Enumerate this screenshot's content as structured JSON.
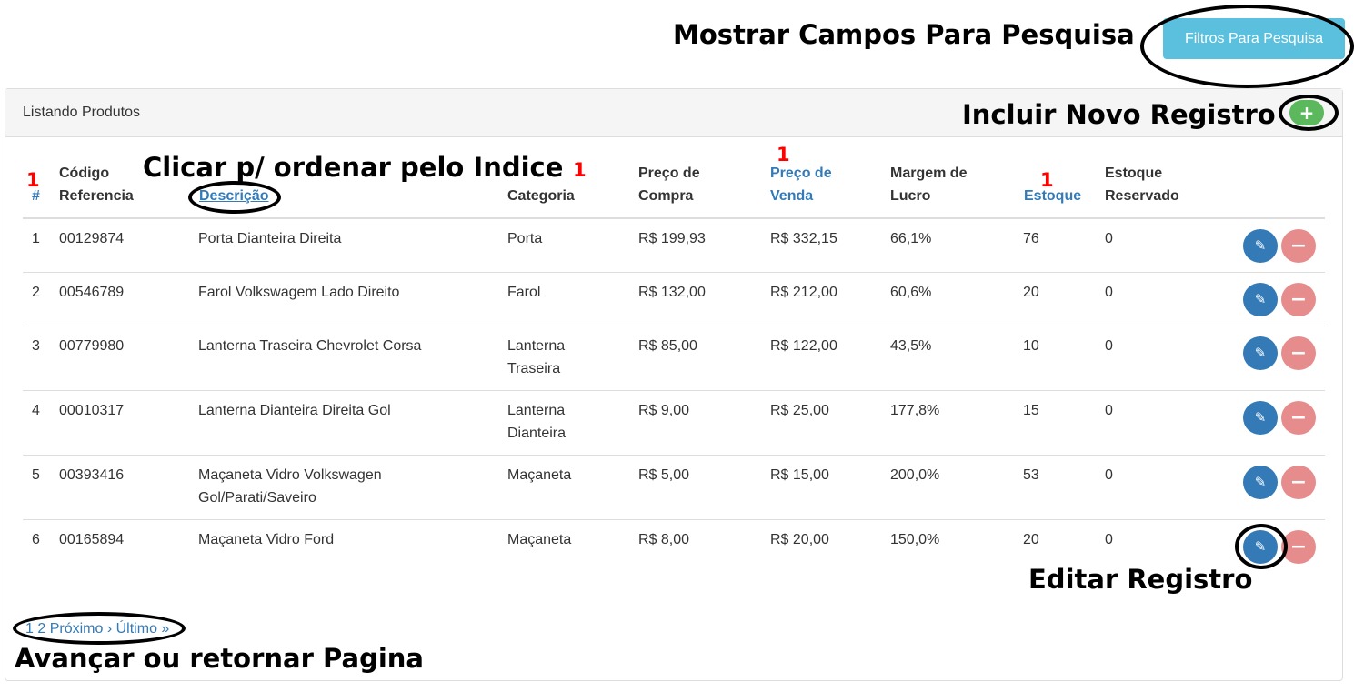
{
  "annotations": {
    "show_fields": "Mostrar Campos Para Pesquisa",
    "add_new": "Incluir Novo Registro",
    "click_sort": "Clicar p/ ordenar pelo Indice",
    "edit_record": "Editar Registro",
    "pagination": "Avançar ou retornar Pagina",
    "markers": [
      "1",
      "1",
      "1",
      "1"
    ]
  },
  "toolbar": {
    "filter_button": "Filtros Para Pesquisa"
  },
  "panel": {
    "title": "Listando Produtos",
    "add_icon": "plus-icon",
    "add_symbol": "+"
  },
  "table": {
    "headers": {
      "index": "#",
      "code_l1": "Código",
      "code_l2": "Referencia",
      "description": "Descrição",
      "category": "Categoria",
      "buy_l1": "Preço de",
      "buy_l2": "Compra",
      "sell_l1": "Preço de",
      "sell_l2": "Venda",
      "margin_l1": "Margem de",
      "margin_l2": "Lucro",
      "stock": "Estoque",
      "reserved_l1": "Estoque",
      "reserved_l2": "Reservado"
    },
    "rows": [
      {
        "index": "1",
        "code": "00129874",
        "desc_l1": "Porta Dianteira Direita",
        "desc_l2": "",
        "cat_l1": "Porta",
        "cat_l2": "",
        "buy": "R$ 199,93",
        "sell": "R$ 332,15",
        "margin": "66,1%",
        "stock": "76",
        "reserved": "0"
      },
      {
        "index": "2",
        "code": "00546789",
        "desc_l1": "Farol Volkswagem Lado Direito",
        "desc_l2": "",
        "cat_l1": "Farol",
        "cat_l2": "",
        "buy": "R$ 132,00",
        "sell": "R$ 212,00",
        "margin": "60,6%",
        "stock": "20",
        "reserved": "0"
      },
      {
        "index": "3",
        "code": "00779980",
        "desc_l1": "Lanterna Traseira Chevrolet Corsa",
        "desc_l2": "",
        "cat_l1": "Lanterna",
        "cat_l2": "Traseira",
        "buy": "R$ 85,00",
        "sell": "R$ 122,00",
        "margin": "43,5%",
        "stock": "10",
        "reserved": "0"
      },
      {
        "index": "4",
        "code": "00010317",
        "desc_l1": "Lanterna Dianteira Direita Gol",
        "desc_l2": "",
        "cat_l1": "Lanterna",
        "cat_l2": "Dianteira",
        "buy": "R$ 9,00",
        "sell": "R$ 25,00",
        "margin": "177,8%",
        "stock": "15",
        "reserved": "0"
      },
      {
        "index": "5",
        "code": "00393416",
        "desc_l1": "Maçaneta Vidro Volkswagen",
        "desc_l2": "Gol/Parati/Saveiro",
        "cat_l1": "Maçaneta",
        "cat_l2": "",
        "buy": "R$ 5,00",
        "sell": "R$ 15,00",
        "margin": "200,0%",
        "stock": "53",
        "reserved": "0"
      },
      {
        "index": "6",
        "code": "00165894",
        "desc_l1": "Maçaneta Vidro Ford",
        "desc_l2": "",
        "cat_l1": "Maçaneta",
        "cat_l2": "",
        "buy": "R$ 8,00",
        "sell": "R$ 20,00",
        "margin": "150,0%",
        "stock": "20",
        "reserved": "0"
      }
    ],
    "actions": {
      "edit_icon": "edit-icon",
      "edit_symbol": "✎",
      "delete_icon": "minus-icon",
      "delete_symbol": "−"
    }
  },
  "pagination": {
    "current": "1",
    "page2": "2",
    "next": "Próximo ›",
    "last": "Último »"
  },
  "colors": {
    "info": "#5bc0de",
    "success": "#5cb85c",
    "primary": "#337ab7",
    "danger_light": "#e78c8c",
    "marker": "#ff0000"
  }
}
